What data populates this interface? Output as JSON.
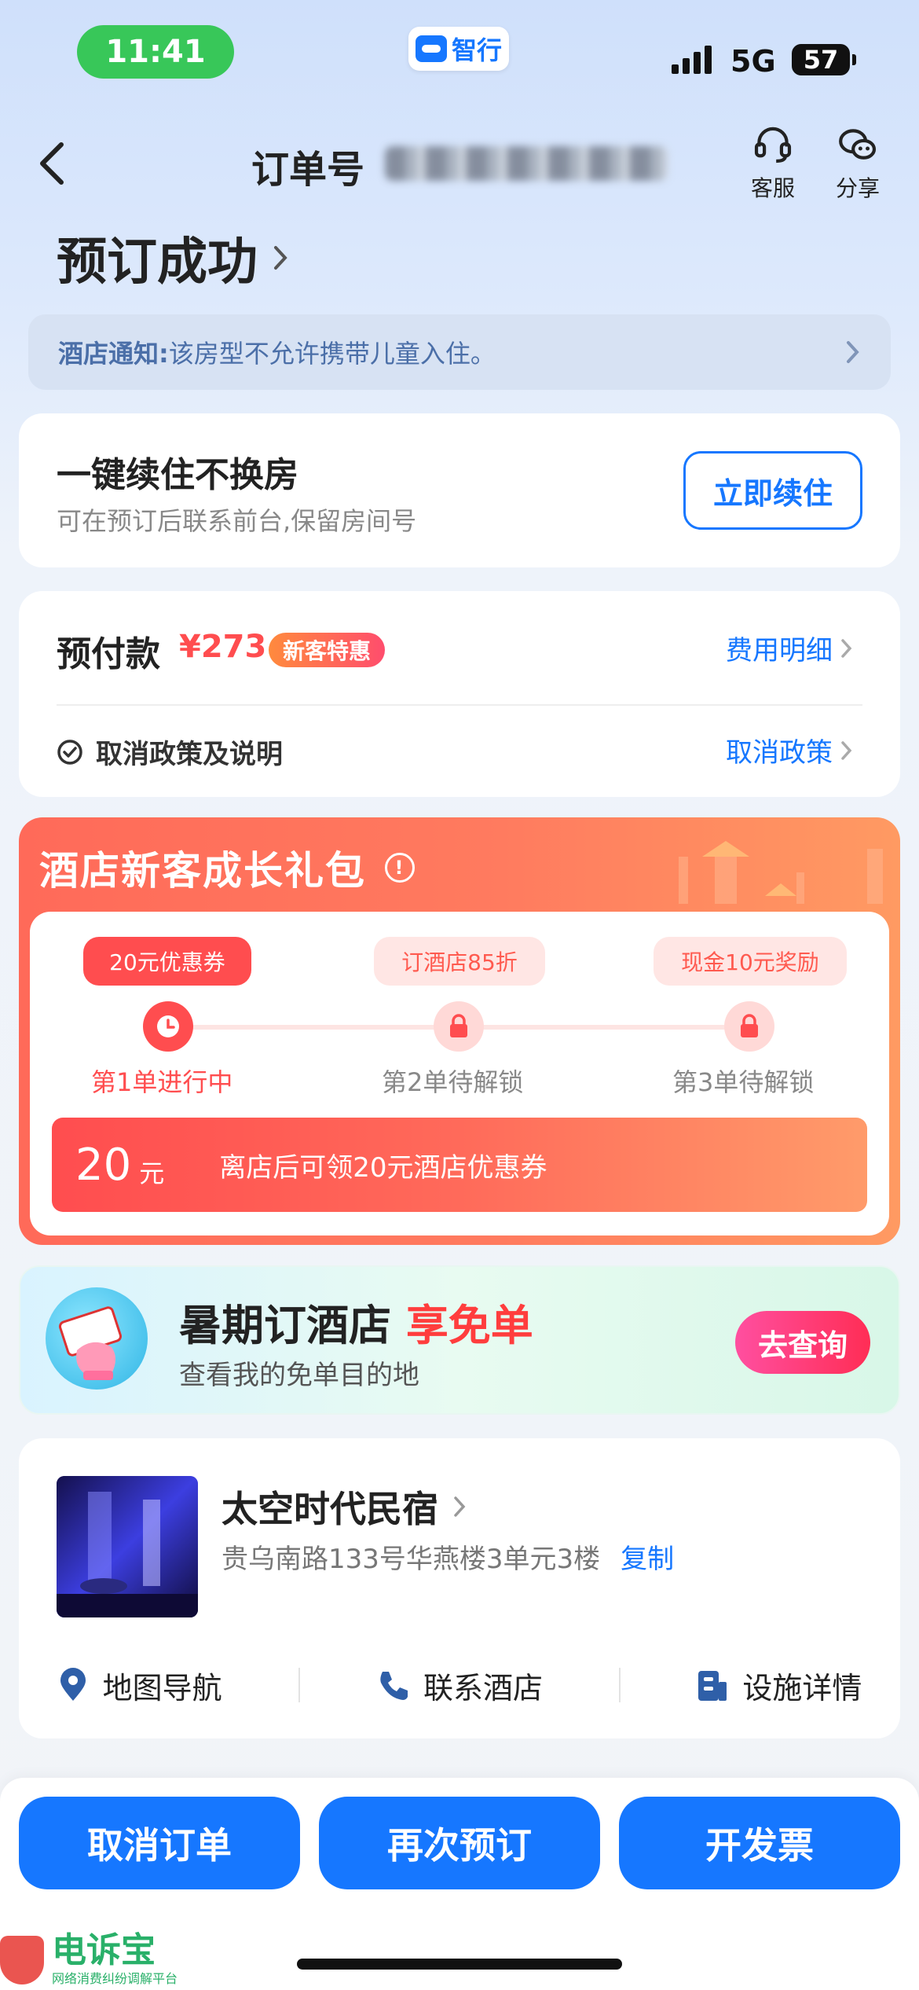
{
  "status_bar": {
    "time": "11:41",
    "network": "5G",
    "battery": "57"
  },
  "app_badge": {
    "label": "智行"
  },
  "nav": {
    "order_label": "订单号",
    "service_label": "客服",
    "share_label": "分享"
  },
  "page_title": "预订成功",
  "notice": {
    "key": "酒店通知:",
    "text": "该房型不允许携带儿童入住。"
  },
  "renew": {
    "title": "一键续住不换房",
    "subtitle": "可在预订后联系前台,保留房间号",
    "button": "立即续住"
  },
  "payment": {
    "label": "预付款",
    "price": "¥273",
    "tag": "新客特惠",
    "detail_link": "费用明细",
    "policy_text": "取消政策及说明",
    "policy_link": "取消政策"
  },
  "gift": {
    "title": "酒店新客成长礼包",
    "info_icon": "!",
    "steps": [
      {
        "chip": "20元优惠券",
        "label": "第1单进行中",
        "state": "active"
      },
      {
        "chip": "订酒店85折",
        "label": "第2单待解锁",
        "state": "locked"
      },
      {
        "chip": "现金10元奖励",
        "label": "第3单待解锁",
        "state": "locked"
      }
    ],
    "reward_amount": "20",
    "reward_unit": "元",
    "reward_text": "离店后可领20元酒店优惠券"
  },
  "promo": {
    "title_main": "暑期订酒店",
    "title_highlight": "享免单",
    "subtitle": "查看我的免单目的地",
    "button": "去查询"
  },
  "hotel": {
    "name": "太空时代民宿",
    "address": "贵乌南路133号华燕楼3单元3楼",
    "copy": "复制",
    "actions": [
      "地图导航",
      "联系酒店",
      "设施详情"
    ]
  },
  "bottom_buttons": [
    "取消订单",
    "再次预订",
    "开发票"
  ],
  "watermark": {
    "name": "电诉宝",
    "tagline": "网络消费纠纷调解平台"
  },
  "colors": {
    "primary": "#1677ff",
    "price": "#ff4d4f",
    "gift": "#ff6a59",
    "promo_btn": "#ff2d55"
  }
}
